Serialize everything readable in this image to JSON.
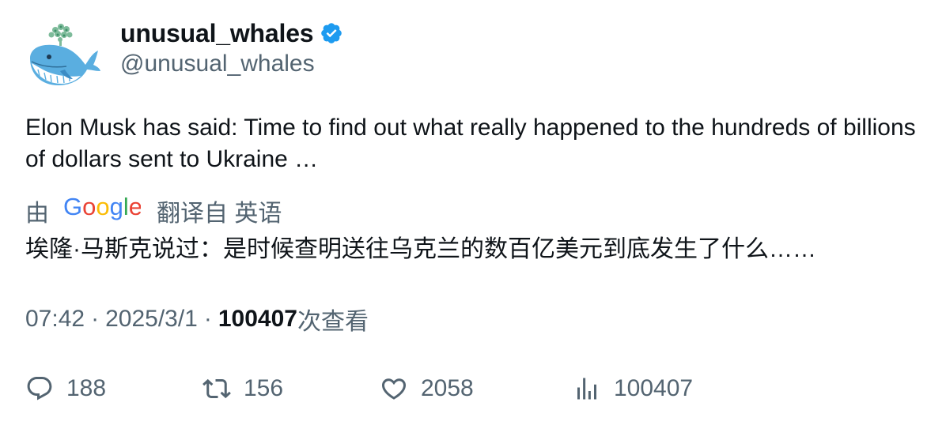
{
  "author": {
    "display_name": "unusual_whales",
    "handle": "@unusual_whales",
    "verified": true,
    "avatar_icon": "whale-icon",
    "verified_icon": "verified-badge-icon",
    "accent_color": "#1d9bf0"
  },
  "tweet": {
    "text": "Elon Musk has said: Time to find out what really happened to the hundreds of billions of dollars sent to Ukraine …",
    "translation": {
      "prefix": "由",
      "provider_logo": "google-logo",
      "suffix": "翻译自 英语",
      "text": "埃隆·马斯克说过：是时候查明送往乌克兰的数百亿美元到底发生了什么……"
    },
    "time": "07:42",
    "separator": "·",
    "date": "2025/3/1",
    "views_count": "100407",
    "views_label": "次查看"
  },
  "actions": {
    "reply": {
      "icon": "reply-icon",
      "count": "188"
    },
    "retweet": {
      "icon": "retweet-icon",
      "count": "156"
    },
    "like": {
      "icon": "heart-icon",
      "count": "2058"
    },
    "views": {
      "icon": "views-chart-icon",
      "count": "100407"
    }
  },
  "colors": {
    "text_primary": "#0f1419",
    "text_secondary": "#536471"
  }
}
